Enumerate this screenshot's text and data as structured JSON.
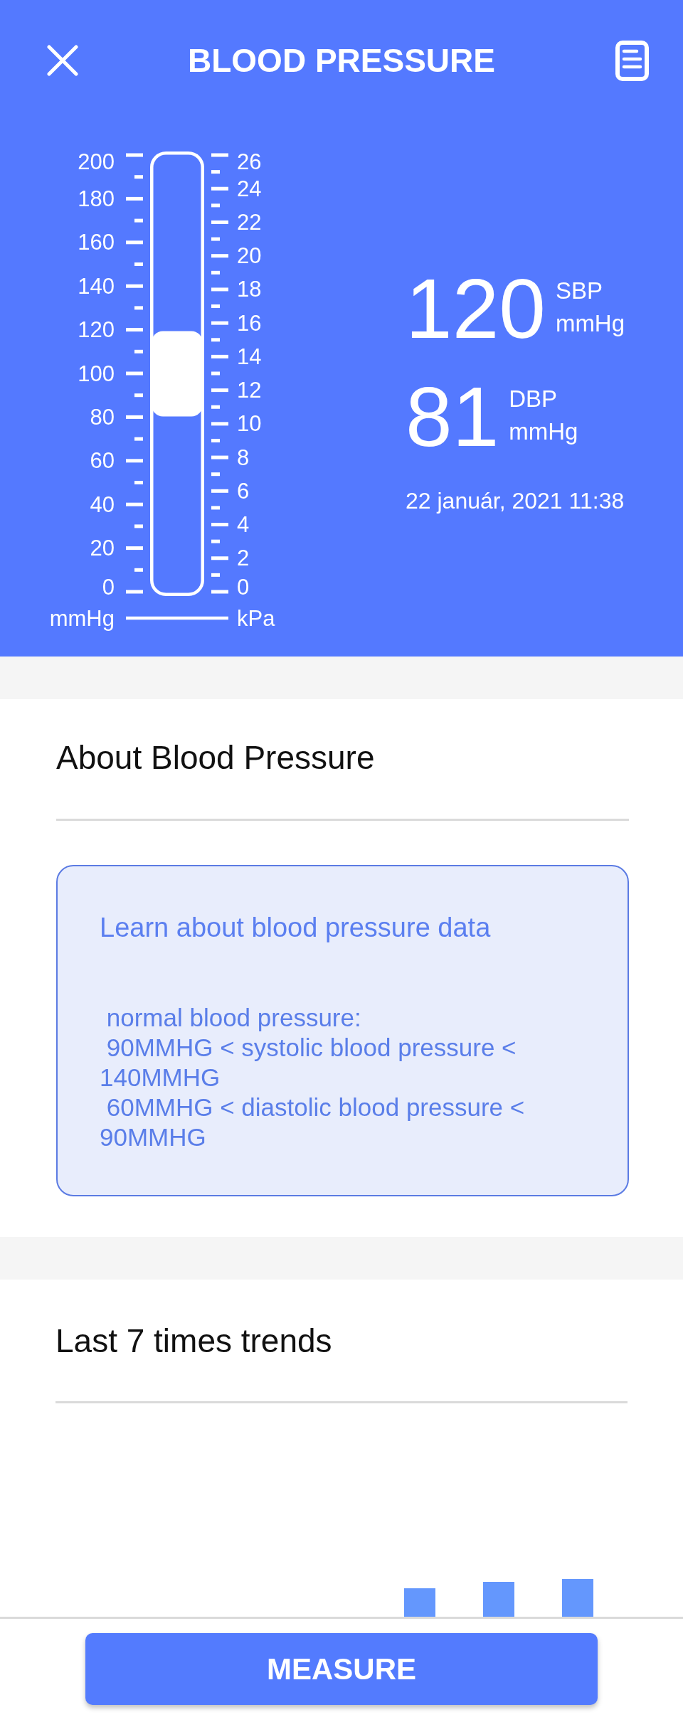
{
  "header": {
    "title": "BLOOD PRESSURE"
  },
  "gauge": {
    "left_scale": {
      "labels": [
        "200",
        "180",
        "160",
        "140",
        "120",
        "100",
        "80",
        "60",
        "40",
        "20",
        "0"
      ],
      "unit": "mmHg"
    },
    "right_scale": {
      "labels": [
        "26",
        "24",
        "22",
        "20",
        "18",
        "16",
        "14",
        "12",
        "10",
        "8",
        "6",
        "4",
        "2",
        "0"
      ],
      "unit": "kPa"
    },
    "thumb": {
      "level": 0.5
    }
  },
  "readings": [
    {
      "value": "120",
      "label": "SBP",
      "unit": "mmHg"
    },
    {
      "value": "81",
      "label": "DBP",
      "unit": "mmHg"
    }
  ],
  "measured_at": "22 január, 2021 11:38",
  "about": {
    "title": "About Blood Pressure",
    "card": {
      "title": "Learn about blood pressure data",
      "text": " normal blood pressure:\n 90MMHG < systolic blood pressure < 140MMHG\n 60MMHG < diastolic blood pressure < 90MMHG"
    }
  },
  "trends": {
    "title": "Last 7 times trends"
  },
  "measure_button": {
    "label": "MEASURE"
  }
}
